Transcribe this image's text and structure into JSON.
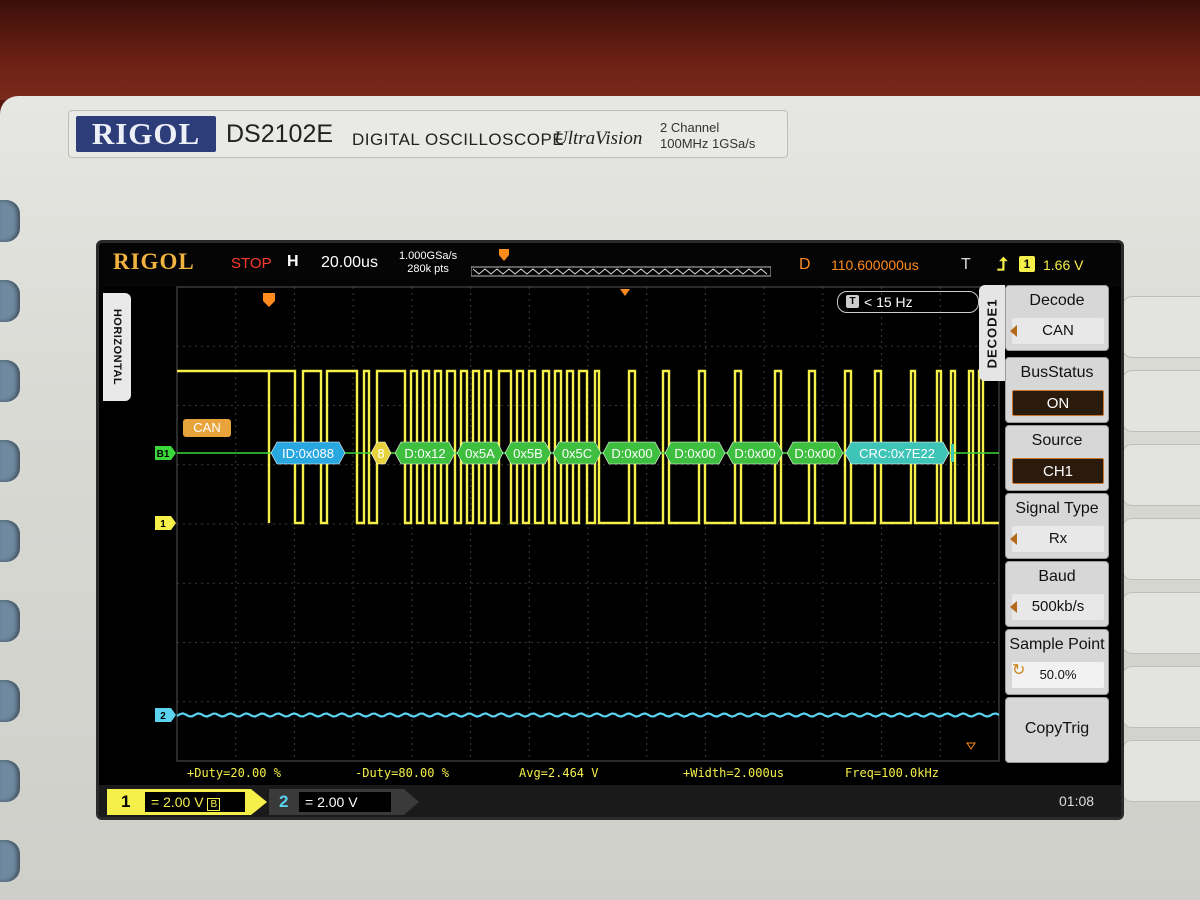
{
  "instrument": {
    "brand": "RIGOL",
    "model": "DS2102E",
    "description": "DIGITAL OSCILLOSCOPE",
    "series": "UltraVision",
    "spec_line1": "2 Channel",
    "spec_line2": "100MHz 1GSa/s"
  },
  "status": {
    "logo": "RIGOL",
    "run_state": "STOP",
    "horizontal_badge": "H",
    "timebase": "20.00us",
    "sample_rate": "1.000GSa/s",
    "memory_depth": "280k pts",
    "delay_label": "D",
    "delay_value": "110.600000us",
    "trigger_label": "T",
    "trigger_channel": "1",
    "trigger_level": "1.66 V"
  },
  "horizontal_tab": "HORIZONTAL",
  "freq_counter": "< 15 Hz",
  "bus": {
    "marker": "B1",
    "protocol_label": "CAN",
    "frames": [
      {
        "text": "ID:0x088",
        "kind": "id"
      },
      {
        "text": "8",
        "kind": "dlc"
      },
      {
        "text": "D:0x12",
        "kind": "data"
      },
      {
        "text": "0x5A",
        "kind": "data"
      },
      {
        "text": "0x5B",
        "kind": "data"
      },
      {
        "text": "0x5C",
        "kind": "data"
      },
      {
        "text": "D:0x00",
        "kind": "data"
      },
      {
        "text": "D:0x00",
        "kind": "data"
      },
      {
        "text": "D:0x00",
        "kind": "data"
      },
      {
        "text": "D:0x00",
        "kind": "data"
      },
      {
        "text": "CRC:0x7E22",
        "kind": "crc"
      }
    ]
  },
  "channel_markers": {
    "ch1": "1",
    "ch2": "2"
  },
  "decode_tab": "DECODE1",
  "menu": [
    {
      "label": "Decode",
      "value": "CAN",
      "style": "arrow"
    },
    {
      "label": "BusStatus",
      "value": "ON",
      "style": "boxed"
    },
    {
      "label": "Source",
      "value": "CH1",
      "style": "boxed"
    },
    {
      "label": "Signal Type",
      "value": "Rx",
      "style": "arrow"
    },
    {
      "label": "Baud",
      "value": "500kb/s",
      "style": "arrow"
    },
    {
      "label": "Sample Point",
      "value": "50.0%",
      "style": "knob"
    },
    {
      "label": "CopyTrig",
      "value": "",
      "style": "plain"
    }
  ],
  "measurements": [
    {
      "text": "+Duty=20.00 %"
    },
    {
      "text": "-Duty=80.00 %"
    },
    {
      "text": "Avg=2.464 V"
    },
    {
      "text": "+Width=2.000us"
    },
    {
      "text": "Freq=100.0kHz"
    }
  ],
  "channels": [
    {
      "number": "1",
      "coupling": "=",
      "scale": "2.00 V",
      "bw": "B"
    },
    {
      "number": "2",
      "coupling": "=",
      "scale": "2.00 V"
    }
  ],
  "clock": "01:08",
  "colors": {
    "ch1": "#f5ef4a",
    "ch2": "#5ad2f0",
    "bus_line": "#3bd83b",
    "id_frame": "#29a7e0",
    "data_frame": "#3fbf3f",
    "dlc_frame": "#e6d23c",
    "crc_frame": "#3fc4b8",
    "label_tag": "#e8a33a",
    "delay_orange": "#ff8a1e"
  }
}
